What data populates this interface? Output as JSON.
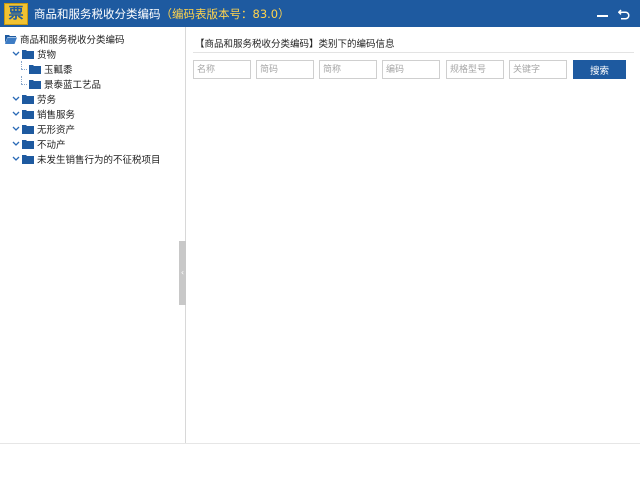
{
  "app": {
    "logo_char": "票",
    "title": "商品和服务税收分类编码",
    "version": "（编码表版本号：83.0）",
    "colors": {
      "titlebar": "#1e5aa0",
      "version_text": "#ffd34d",
      "button": "#1e5aa0",
      "folder": "#1e5aa0"
    }
  },
  "title_actions": {
    "minimize_icon": "minimize-icon",
    "back_icon": "back-icon"
  },
  "tree": {
    "root_label": "商品和服务税收分类编码",
    "items": [
      {
        "label": "货物",
        "expanded": true,
        "children": [
          {
            "label": "玉瓤黍"
          },
          {
            "label": "景泰蓝工艺品"
          }
        ]
      },
      {
        "label": "劳务"
      },
      {
        "label": "销售服务"
      },
      {
        "label": "无形资产"
      },
      {
        "label": "不动产"
      },
      {
        "label": "未发生销售行为的不征税项目"
      }
    ]
  },
  "splitter": {
    "glyph": "‹"
  },
  "main": {
    "section_title": "【商品和服务税收分类编码】类别下的编码信息",
    "search": {
      "fields": [
        {
          "placeholder": "名称"
        },
        {
          "placeholder": "简码"
        },
        {
          "placeholder": "简称"
        },
        {
          "placeholder": "编码"
        },
        {
          "placeholder": "规格型号"
        },
        {
          "placeholder": "关键字"
        }
      ],
      "button_label": "搜索"
    }
  }
}
